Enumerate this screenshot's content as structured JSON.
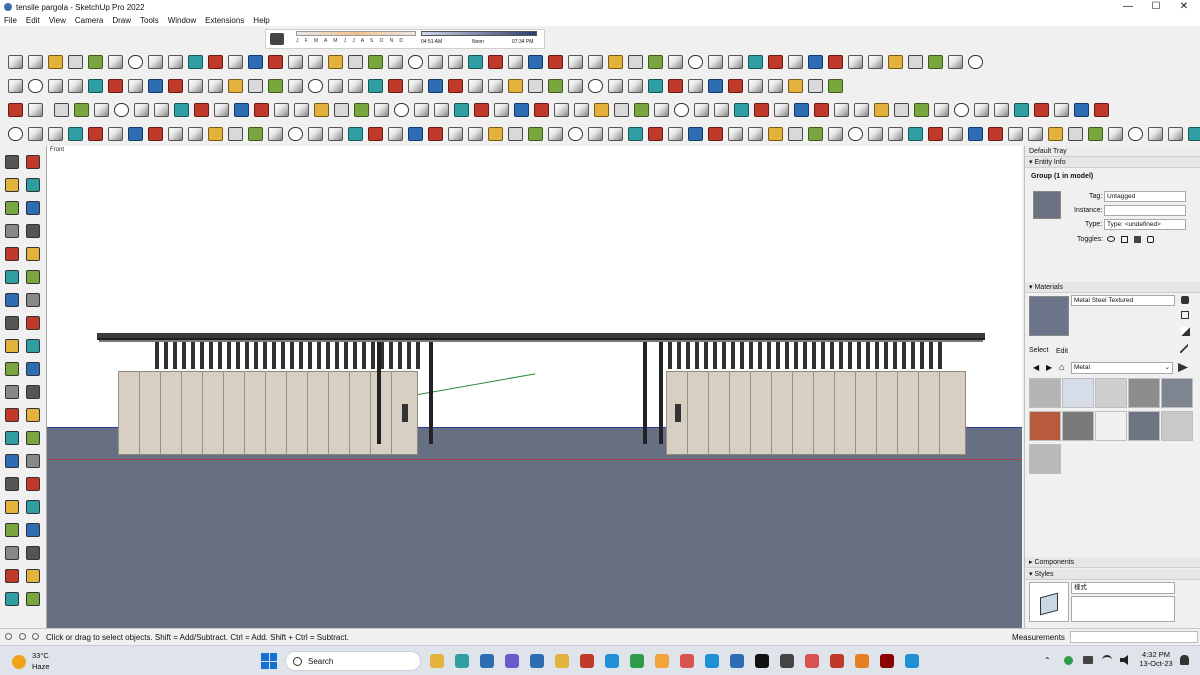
{
  "window": {
    "title": "tensile pargola - SketchUp Pro 2022",
    "minimize": "—",
    "maximize": "☐",
    "close": "✕"
  },
  "menu": [
    "File",
    "Edit",
    "View",
    "Camera",
    "Draw",
    "Tools",
    "Window",
    "Extensions",
    "Help"
  ],
  "shadows": {
    "months": "J F M A M J J A S O N D",
    "time_start": "04:51 AM",
    "time_mid": "Noon",
    "time_end": "07:34 PM"
  },
  "viewport": {
    "scene_label": "Front"
  },
  "tray": {
    "title": "Default Tray",
    "entity_info": {
      "header": "Entity Info",
      "selection": "Group (1 in model)",
      "tag_label": "Tag:",
      "tag_value": "Untagged",
      "instance_label": "Instance:",
      "instance_value": "",
      "type_label": "Type:",
      "type_value": "Type: <undefined>",
      "toggles_label": "Toggles:"
    },
    "materials": {
      "header": "Materials",
      "current_name": "Metal Steel Textured",
      "tab_select": "Select",
      "tab_edit": "Edit",
      "library": "Metal",
      "swatch_colors": [
        "#b5b5b5",
        "#d6dde8",
        "#cfcfcf",
        "#8c8c8c",
        "#7f8590",
        "#b85a3c",
        "#7a7a7a",
        "#f0f0f0",
        "#6f7482",
        "#c9c9c9",
        "#b9b9b9"
      ]
    },
    "components_header": "Components",
    "styles": {
      "header": "Styles",
      "style_name": "樣式"
    }
  },
  "statusbar": {
    "hint": "Click or drag to select objects. Shift = Add/Subtract. Ctrl = Add. Shift + Ctrl = Subtract.",
    "measurements_label": "Measurements",
    "measurements_value": ""
  },
  "taskbar": {
    "temperature": "33°C",
    "weather": "Haze",
    "search": "Search",
    "time": "4:32 PM",
    "date": "13-Oct-23"
  },
  "colors": {
    "ground": "#677083",
    "wall": "#d7d0c2",
    "roof": "#3a3a3a",
    "accent": "#1570d6"
  }
}
